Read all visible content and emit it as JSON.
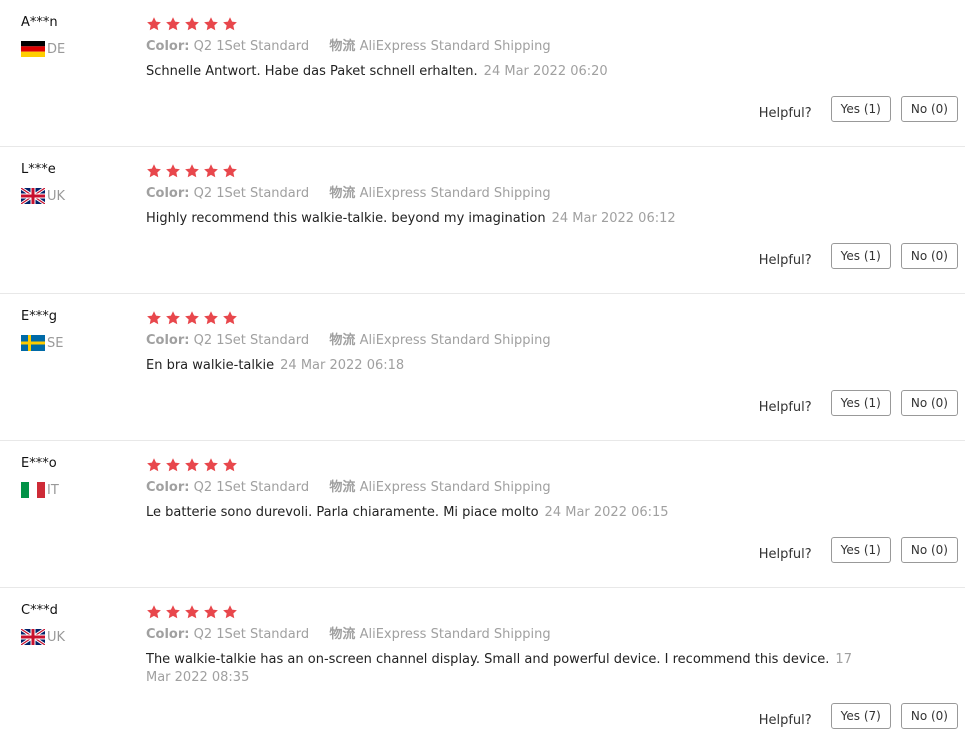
{
  "helpful_label": "Helpful?",
  "color_label": "Color:",
  "shipping_label": "物流",
  "star_color": "#e8474c",
  "reviews": [
    {
      "name": "A***n",
      "country": "DE",
      "flag": "germany-flag",
      "rating": 5,
      "color": "Q2 1Set Standard",
      "shipping": "AliExpress Standard Shipping",
      "text": "Schnelle Antwort. Habe das Paket schnell erhalten.",
      "time": "24 Mar 2022 06:20",
      "yes": "Yes (1)",
      "no": "No (0)"
    },
    {
      "name": "L***e",
      "country": "UK",
      "flag": "uk-flag",
      "rating": 5,
      "color": "Q2 1Set Standard",
      "shipping": "AliExpress Standard Shipping",
      "text": "Highly recommend this walkie-talkie. beyond my imagination",
      "time": "24 Mar 2022 06:12",
      "yes": "Yes (1)",
      "no": "No (0)"
    },
    {
      "name": "E***g",
      "country": "SE",
      "flag": "sweden-flag",
      "rating": 5,
      "color": "Q2 1Set Standard",
      "shipping": "AliExpress Standard Shipping",
      "text": "En bra walkie-talkie",
      "time": "24 Mar 2022 06:18",
      "yes": "Yes (1)",
      "no": "No (0)"
    },
    {
      "name": "E***o",
      "country": "IT",
      "flag": "italy-flag",
      "rating": 5,
      "color": "Q2 1Set Standard",
      "shipping": "AliExpress Standard Shipping",
      "text": "Le batterie sono durevoli. Parla chiaramente. Mi piace molto",
      "time": "24 Mar 2022 06:15",
      "yes": "Yes (1)",
      "no": "No (0)"
    },
    {
      "name": "C***d",
      "country": "UK",
      "flag": "uk-flag",
      "rating": 5,
      "color": "Q2 1Set Standard",
      "shipping": "AliExpress Standard Shipping",
      "text": "The walkie-talkie has an on-screen channel display. Small and powerful device. I recommend this device.",
      "time": "17 Mar 2022 08:35",
      "yes": "Yes (7)",
      "no": "No (0)"
    }
  ]
}
